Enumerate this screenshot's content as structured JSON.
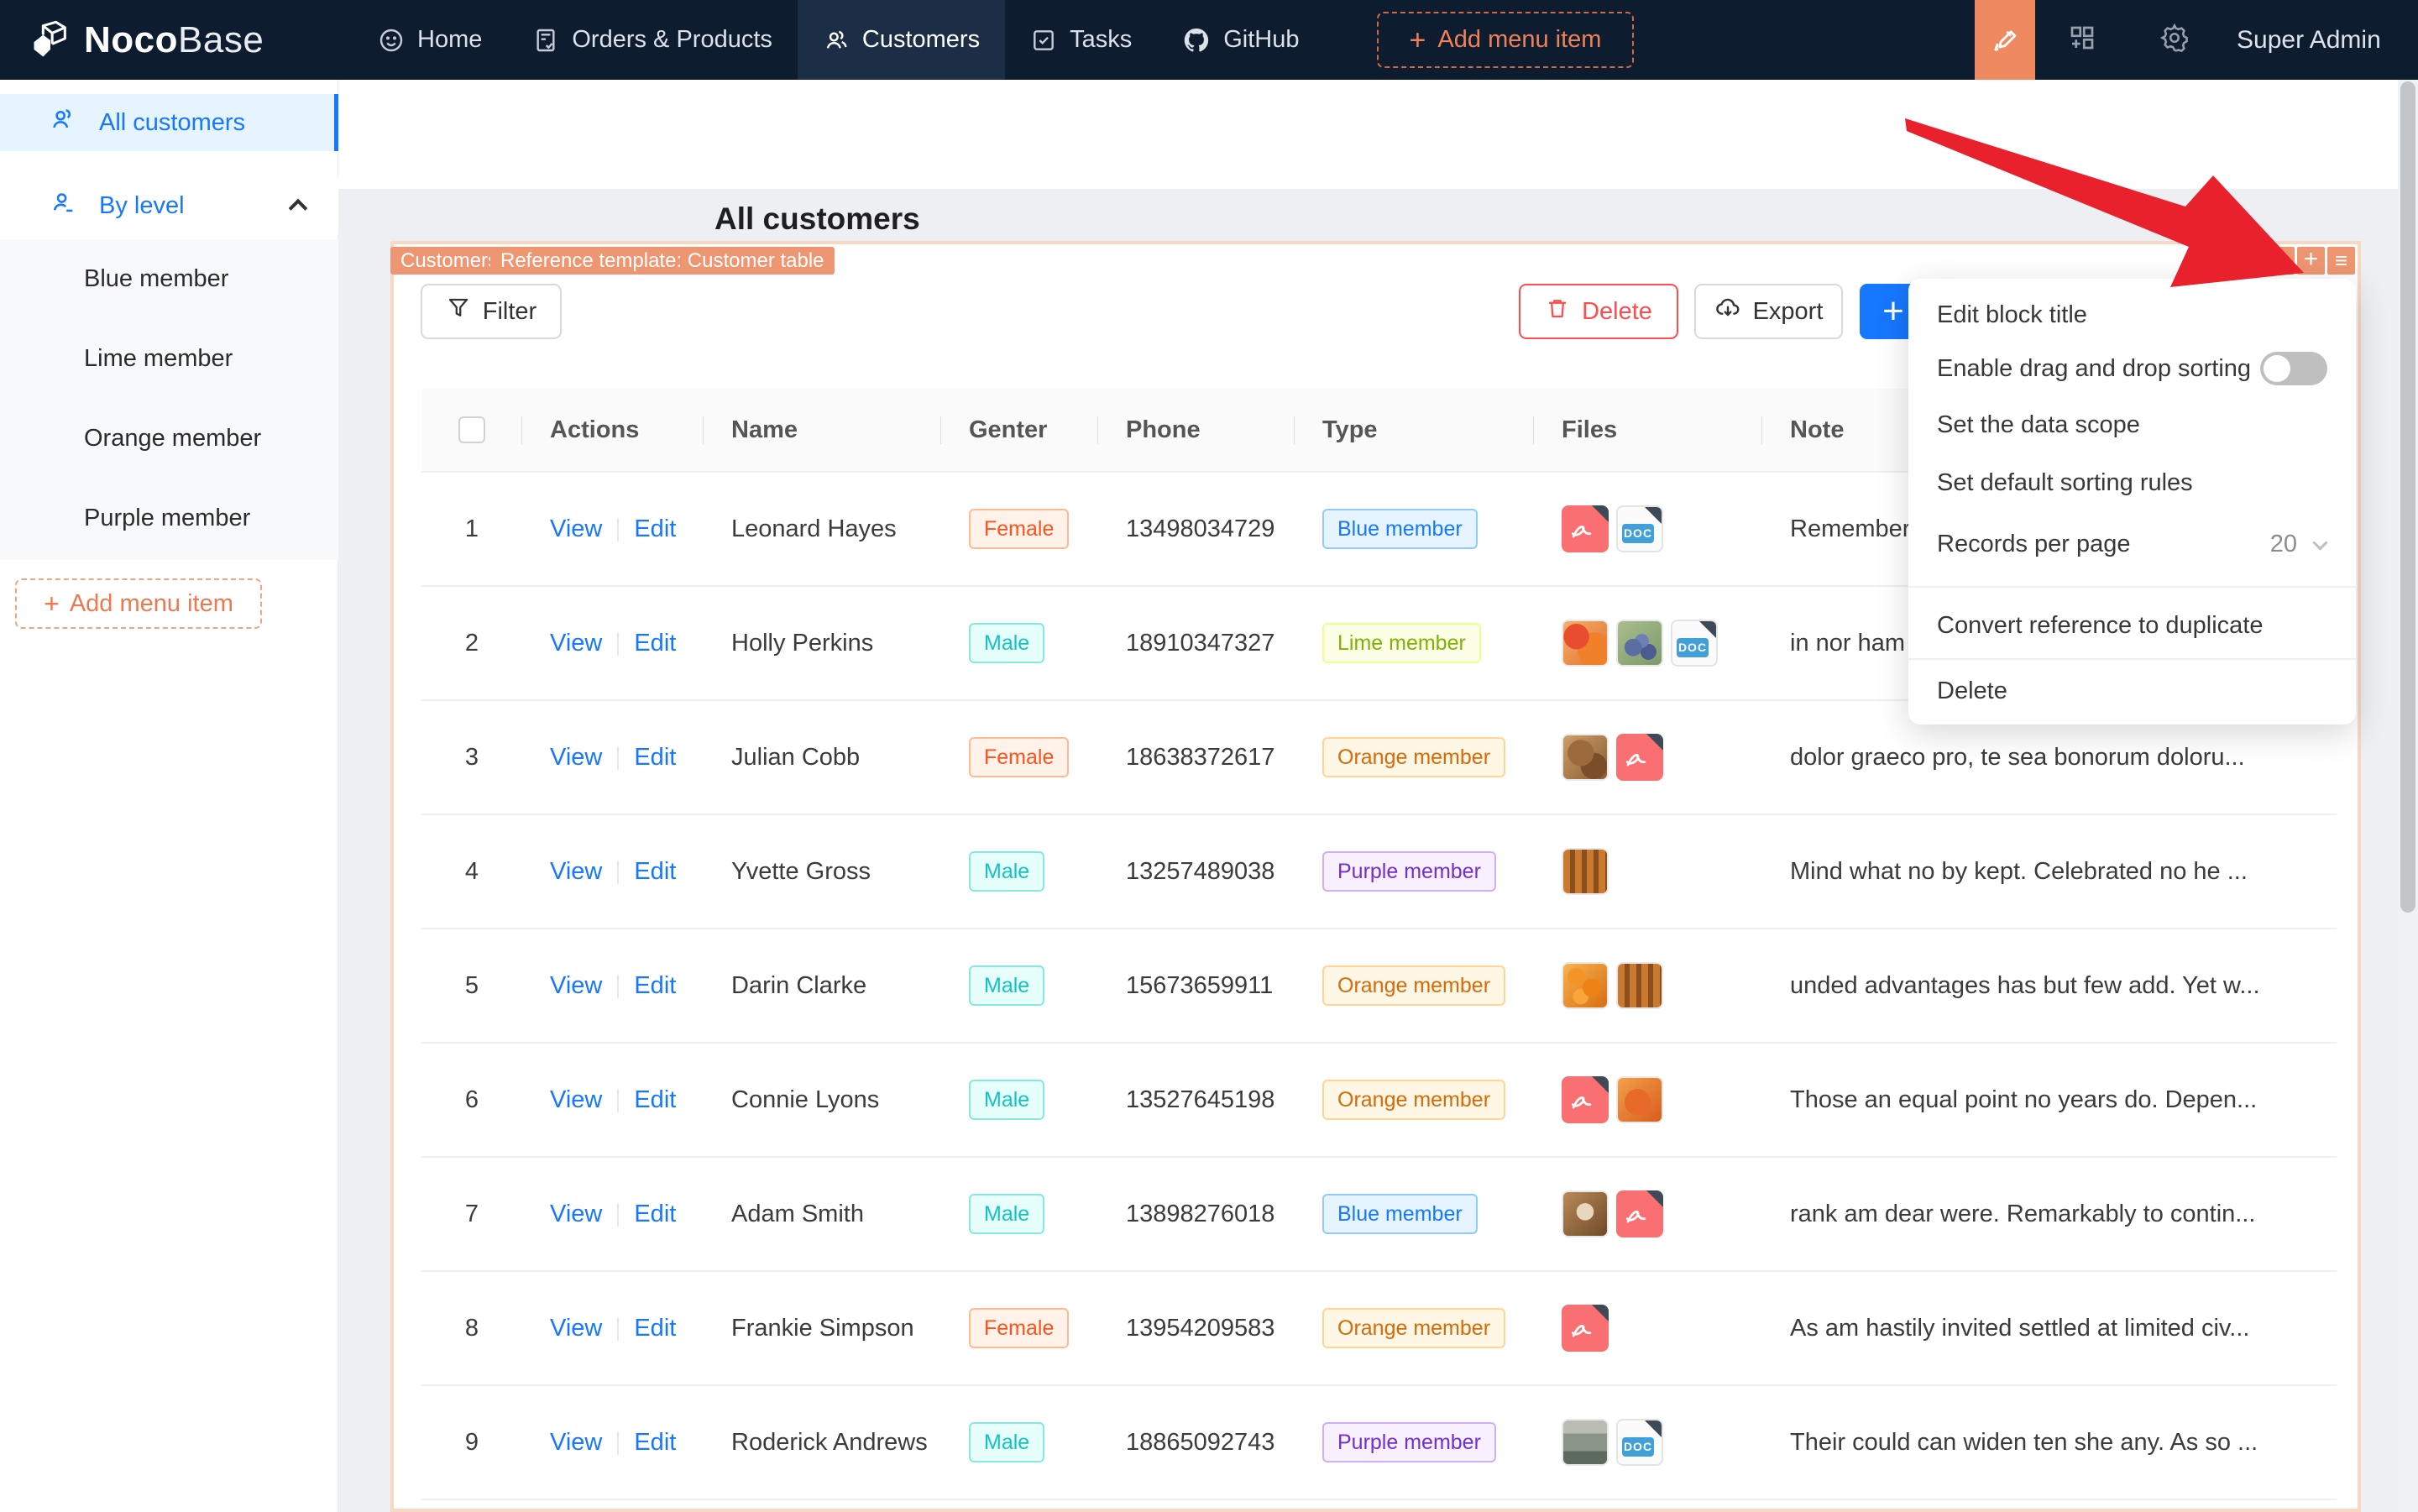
{
  "navbar": {
    "logo_bold": "Noco",
    "logo_light": "Base",
    "items": [
      {
        "label": "Home"
      },
      {
        "label": "Orders & Products"
      },
      {
        "label": "Customers"
      },
      {
        "label": "Tasks"
      },
      {
        "label": "GitHub"
      }
    ],
    "add_menu_item_label": "Add menu item",
    "user": "Super Admin"
  },
  "sidebar": {
    "all_customers_label": "All customers",
    "by_level_label": "By level",
    "sub_items": [
      "Blue member",
      "Lime member",
      "Orange member",
      "Purple member"
    ],
    "add_menu_item_label": "Add menu item"
  },
  "page": {
    "title": "All customers"
  },
  "block": {
    "tags": [
      "Customers",
      "Reference template: Customer table"
    ],
    "toolbar": {
      "filter": "Filter",
      "delete": "Delete",
      "export": "Export",
      "add": "+"
    }
  },
  "settings_menu": {
    "edit_block_title": "Edit block title",
    "enable_drag": "Enable drag and drop sorting",
    "set_data_scope": "Set the data scope",
    "set_sorting_rules": "Set default sorting rules",
    "records_per_page_label": "Records per page",
    "records_per_page_value": "20",
    "convert_reference": "Convert reference to duplicate",
    "delete": "Delete",
    "drag_toggle_on": false
  },
  "table": {
    "headers": [
      "",
      "Actions",
      "Name",
      "Genter",
      "Phone",
      "Type",
      "Files",
      "Note"
    ],
    "action_labels": [
      "View",
      "Edit"
    ],
    "rows": [
      {
        "index": "1",
        "name": "Leonard Hayes",
        "gender": "Female",
        "phone": "13498034729",
        "type": "Blue member",
        "files": [
          "pdf",
          "doc"
        ],
        "note": "Remember"
      },
      {
        "index": "2",
        "name": "Holly Perkins",
        "gender": "Male",
        "phone": "18910347327",
        "type": "Lime member",
        "files": [
          "img-pomegranate",
          "img-grapes",
          "doc"
        ],
        "note": "in nor ham"
      },
      {
        "index": "3",
        "name": "Julian Cobb",
        "gender": "Female",
        "phone": "18638372617",
        "type": "Orange member",
        "files": [
          "img-food",
          "pdf"
        ],
        "note": "dolor graeco pro, te sea bonorum doloru..."
      },
      {
        "index": "4",
        "name": "Yvette Gross",
        "gender": "Male",
        "phone": "13257489038",
        "type": "Purple member",
        "files": [
          "img-skewers"
        ],
        "note": "Mind what no by kept. Celebrated no he ..."
      },
      {
        "index": "5",
        "name": "Darin Clarke",
        "gender": "Male",
        "phone": "15673659911",
        "type": "Orange member",
        "files": [
          "img-oranges",
          "img-skewers"
        ],
        "note": "unded advantages has but few add. Yet w..."
      },
      {
        "index": "6",
        "name": "Connie Lyons",
        "gender": "Male",
        "phone": "13527645198",
        "type": "Orange member",
        "files": [
          "pdf",
          "img-orangefruit"
        ],
        "note": "Those an equal point no years do. Depen..."
      },
      {
        "index": "7",
        "name": "Adam Smith",
        "gender": "Male",
        "phone": "13898276018",
        "type": "Blue member",
        "files": [
          "img-coffee",
          "pdf"
        ],
        "note": "rank am dear were. Remarkably to contin..."
      },
      {
        "index": "8",
        "name": "Frankie Simpson",
        "gender": "Female",
        "phone": "13954209583",
        "type": "Orange member",
        "files": [
          "pdf"
        ],
        "note": "As am hastily invited settled at limited civ..."
      },
      {
        "index": "9",
        "name": "Roderick Andrews",
        "gender": "Male",
        "phone": "18865092743",
        "type": "Purple member",
        "files": [
          "img-storefront",
          "doc"
        ],
        "note": "Their could can widen ten she any. As so ..."
      }
    ]
  },
  "colors": {
    "accent_orange": "#ed7a4f",
    "tag_orange": "#ee9671",
    "primary_blue": "#1677ff",
    "danger_red": "#ff4d4f",
    "arrow_red": "#e8212d",
    "navbar_bg": "#0e1c30"
  }
}
